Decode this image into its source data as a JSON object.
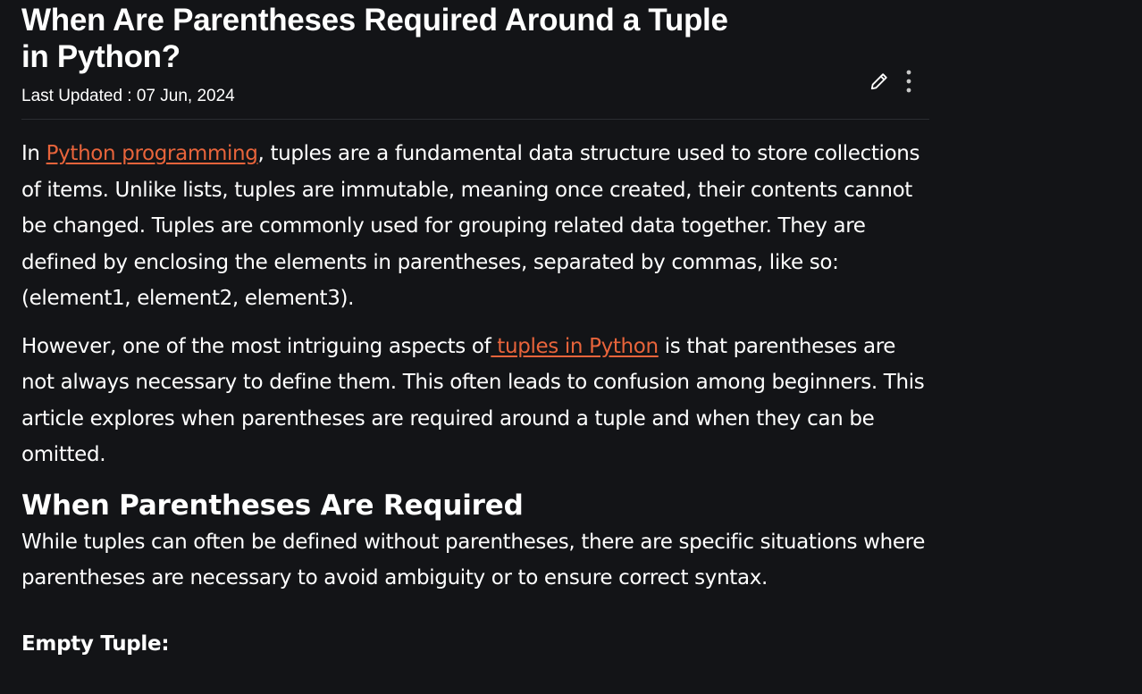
{
  "article": {
    "title": "When Are Parentheses Required Around a Tuple in Python?",
    "last_updated": "Last Updated : 07 Jun, 2024",
    "p1": {
      "pre": "In ",
      "link": "Python programming",
      "post": ", tuples are a fundamental data structure used to store collections of items. Unlike lists, tuples are immutable, meaning once created, their contents cannot be changed. Tuples are commonly used for grouping related data together. They are defined by enclosing the elements in parentheses, separated by commas, like so: (element1, element2, element3)."
    },
    "p2": {
      "pre": "However, one of the most intriguing aspects of",
      "link": " tuples in Python",
      "post": " is that parentheses are not always necessary to define them. This often leads to confusion among beginners. This article explores when parentheses are required around a tuple and when they can be omitted."
    },
    "section_heading": "When Parentheses Are Required",
    "p3": "While tuples can often be defined without parentheses, there are specific situations where parentheses are necessary to avoid ambiguity or to ensure correct syntax.",
    "sub_heading": "Empty Tuple:"
  },
  "icons": {
    "edit": "pencil-icon",
    "more": "more-vertical-icon"
  },
  "colors": {
    "background": "#131417",
    "text": "#ffffff",
    "link": "#e8643b",
    "divider": "#2b2d31"
  }
}
